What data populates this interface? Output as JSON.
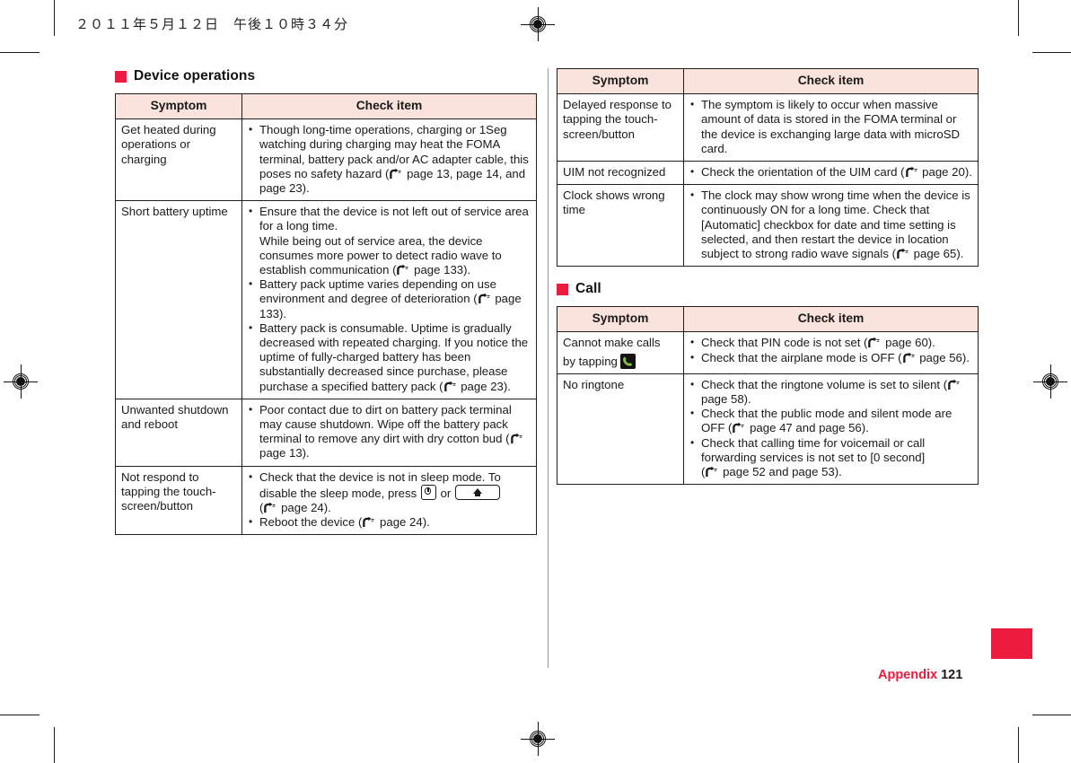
{
  "page": {
    "datestamp": "２０１１年５月１２日　午後１０時３４分",
    "footer_label": "Appendix",
    "footer_page": "121"
  },
  "sections": [
    {
      "id": "device-operations",
      "title": "Device operations",
      "table": {
        "headers": [
          "Symptom",
          "Check item"
        ],
        "rows": [
          {
            "symptom": "Get heated during operations or charging",
            "items": [
              "Though long-time operations, charging or 1Seg watching during charging may heat the FOMA terminal, battery pack and/or AC adapter cable, this poses no safety hazard (☞ page 13, page 14, and page 23)."
            ]
          },
          {
            "symptom": "Short battery uptime",
            "items": [
              "Ensure that the device is not left out of service area for a long time.\nWhile being out of service area, the device consumes more power to detect radio wave to establish communication (☞ page 133).",
              "Battery pack uptime varies depending on use environment and degree of deterioration (☞ page 133).",
              "Battery pack is consumable. Uptime is gradually decreased with repeated charging. If you notice the uptime of fully-charged battery has been substantially decreased since purchase, please purchase a specified battery pack (☞ page 23)."
            ]
          },
          {
            "symptom": "Unwanted shutdown and reboot",
            "items": [
              "Poor contact due to dirt on battery pack terminal may cause shutdown. Wipe off the battery pack terminal to remove any dirt with dry cotton bud (☞ page 13)."
            ]
          },
          {
            "symptom": "Not respond to tapping the touch-screen/button",
            "items": [
              "Check that the device is not in sleep mode. To disable the sleep mode, press [power-key] or [home-key] (☞ page 24).",
              "Reboot the device (☞ page 24)."
            ]
          }
        ]
      }
    },
    {
      "id": "call",
      "title": "Call",
      "table": {
        "headers": [
          "Symptom",
          "Check item"
        ],
        "rows": [
          {
            "symptom": "Delayed response to tapping the touch-screen/button",
            "items": [
              "The symptom is likely to occur when massive amount of data is stored in the FOMA terminal or the device is exchanging large data with microSD card."
            ]
          },
          {
            "symptom": "UIM not recognized",
            "items": [
              "Check the orientation of the UIM card (☞ page 20)."
            ]
          },
          {
            "symptom": "Clock shows wrong time",
            "items": [
              "The clock may show wrong time when the device is continuously ON for a long time. Check that [Automatic] checkbox for date and time setting is selected, and then restart the device in location subject to strong radio wave signals (☞ page 65)."
            ]
          },
          {
            "symptom": "Cannot make calls by tapping [phone-icon]",
            "items": [
              "Check that PIN code is not set (☞ page 60).",
              "Check that the airplane mode is OFF (☞ page 56)."
            ]
          },
          {
            "symptom": "No ringtone",
            "items": [
              "Check that the ringtone volume is set to silent (☞ page 58).",
              "Check that the public mode and silent mode are OFF (☞ page 47 and page 56).",
              "Check that calling time for voicemail or call forwarding services is not set to [0 second] (☞ page 52 and page 53)."
            ]
          }
        ]
      }
    }
  ],
  "left_table": {
    "header_symptom": "Symptom",
    "header_check": "Check item",
    "r1": {
      "symptom": "Get heated during operations or charging",
      "i1a": "Though long-time operations, charging or 1Seg watching during charging may heat the FOMA terminal, battery pack and/or AC adapter cable, this poses no safety hazard (",
      "i1b": " page 13, page 14, and page 23)."
    },
    "r2": {
      "symptom": "Short battery uptime",
      "i1a": "Ensure that the device is not left out of service area for a long time.",
      "i1b": "While being out of service area, the device consumes more power to detect radio wave to establish communication (",
      "i1c": " page 133).",
      "i2a": "Battery pack uptime varies depending on use environment and degree of deterioration (",
      "i2b": " page 133).",
      "i3a": "Battery pack is consumable. Uptime is gradually decreased with repeated charging. If you notice the uptime of fully-charged battery has been substantially decreased since purchase, please purchase a specified battery pack (",
      "i3b": " page 23)."
    },
    "r3": {
      "symptom": "Unwanted shutdown and reboot",
      "i1a": "Poor contact due to dirt on battery pack terminal may cause shutdown. Wipe off the battery pack terminal to remove any dirt with dry cotton bud (",
      "i1b": " page 13)."
    },
    "r4": {
      "symptom": "Not respond to tapping the touch-screen/button",
      "i1a": "Check that the device is not in sleep mode. To disable the sleep mode, press",
      "i1or": "or",
      "i1b": "(",
      "i1c": " page 24).",
      "i2a": "Reboot the device (",
      "i2b": " page 24)."
    }
  },
  "right_table_top": {
    "header_symptom": "Symptom",
    "header_check": "Check item",
    "r1": {
      "symptom": "Delayed response to tapping the touch-screen/button",
      "i1": "The symptom is likely to occur when massive amount of data is stored in the FOMA terminal or the device is exchanging large data with microSD card."
    },
    "r2": {
      "symptom": "UIM not recognized",
      "i1a": "Check the orientation of the UIM card (",
      "i1b": " page 20)."
    },
    "r3": {
      "symptom": "Clock shows wrong time",
      "i1a": "The clock may show wrong time when the device is continuously ON for a long time. Check that [Automatic] checkbox for date and time setting is selected, and then restart the device in location subject to strong radio wave signals (",
      "i1b": " page 65)."
    }
  },
  "right_table_call": {
    "header_symptom": "Symptom",
    "header_check": "Check item",
    "r1": {
      "symptom_a": "Cannot make calls",
      "symptom_b": "by tapping",
      "i1a": "Check that PIN code is not set (",
      "i1b": " page 60).",
      "i2a": "Check that the airplane mode is OFF (",
      "i2b": " page 56)."
    },
    "r2": {
      "symptom": "No ringtone",
      "i1a": "Check that the ringtone volume is set to silent (",
      "i1b": " page 58).",
      "i2a": "Check that the public mode and silent mode are OFF (",
      "i2b": " page 47 and page 56).",
      "i3a": "Check that calling time for voicemail or call forwarding services is not set to [0 second]",
      "i3b": "(",
      "i3c": " page 52 and page 53)."
    }
  },
  "headings": {
    "device_operations": "Device operations",
    "call": "Call"
  },
  "colors": {
    "accent_red": "#ED1B3E",
    "table_header_bg": "#FBE3DD",
    "border": "#221C1C",
    "phone_icon_green": "#7DC243"
  }
}
